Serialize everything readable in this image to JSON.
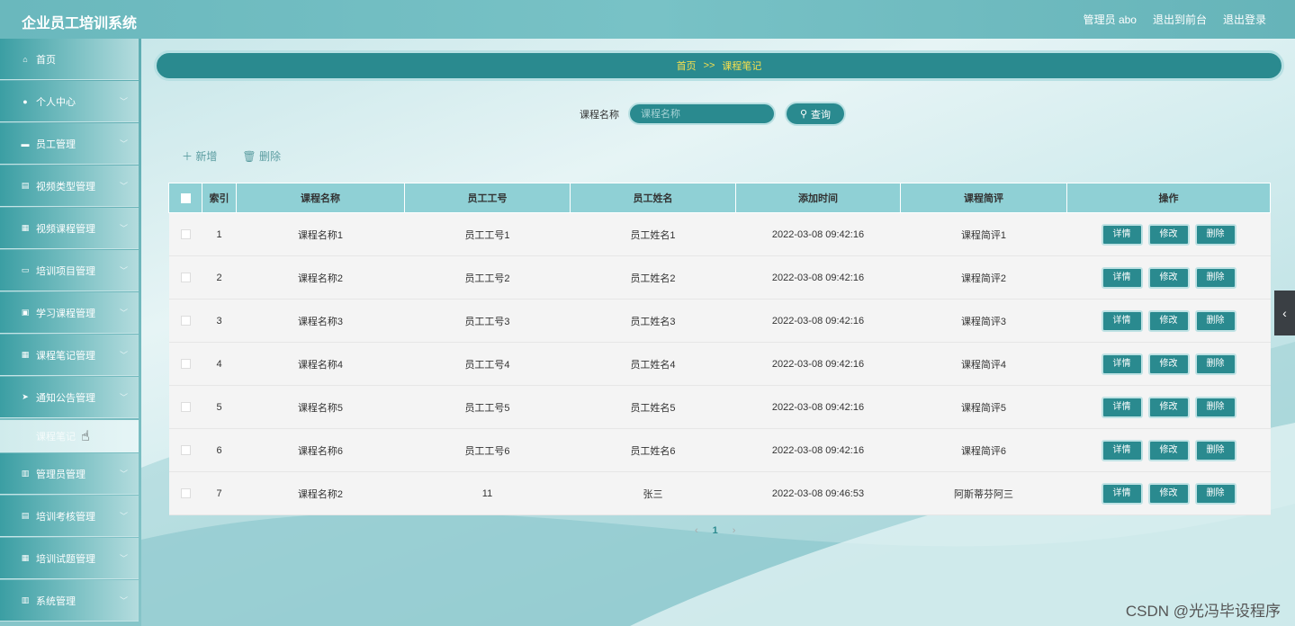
{
  "header": {
    "title": "企业员工培训系统",
    "user": "管理员 abo",
    "to_front": "退出到前台",
    "logout": "退出登录"
  },
  "sidebar": {
    "items": [
      {
        "label": "首页",
        "icon": "home-icon",
        "glyph": "⌂"
      },
      {
        "label": "个人中心",
        "icon": "user-icon",
        "glyph": "●"
      },
      {
        "label": "员工管理",
        "icon": "briefcase-icon",
        "glyph": "▬"
      },
      {
        "label": "视频类型管理",
        "icon": "document-icon",
        "glyph": "▤"
      },
      {
        "label": "视频课程管理",
        "icon": "grid-icon",
        "glyph": "▦"
      },
      {
        "label": "培训项目管理",
        "icon": "monitor-icon",
        "glyph": "▭"
      },
      {
        "label": "学习课程管理",
        "icon": "id-card-icon",
        "glyph": "▣"
      },
      {
        "label": "课程笔记管理",
        "icon": "grid-icon",
        "glyph": "▦"
      },
      {
        "label": "通知公告管理",
        "icon": "send-icon",
        "glyph": "➤"
      }
    ],
    "submenu_label": "课程笔记",
    "items_after": [
      {
        "label": "管理员管理",
        "icon": "bar-chart-icon",
        "glyph": "▥"
      },
      {
        "label": "培训考核管理",
        "icon": "document-icon",
        "glyph": "▤"
      },
      {
        "label": "培训试题管理",
        "icon": "grid-icon",
        "glyph": "▦"
      },
      {
        "label": "系统管理",
        "icon": "chart-icon",
        "glyph": "▥"
      }
    ]
  },
  "breadcrumb": {
    "home": "首页",
    "sep": ">>",
    "current": "课程笔记"
  },
  "search": {
    "label": "课程名称",
    "placeholder": "课程名称",
    "button": "查询"
  },
  "toolbar": {
    "add": "新增",
    "delete": "删除"
  },
  "table": {
    "columns": [
      "索引",
      "课程名称",
      "员工工号",
      "员工姓名",
      "添加时间",
      "课程简评",
      "操作"
    ],
    "rows": [
      {
        "index": "1",
        "course": "课程名称1",
        "emp_no": "员工工号1",
        "emp_name": "员工姓名1",
        "time": "2022-03-08 09:42:16",
        "review": "课程简评1"
      },
      {
        "index": "2",
        "course": "课程名称2",
        "emp_no": "员工工号2",
        "emp_name": "员工姓名2",
        "time": "2022-03-08 09:42:16",
        "review": "课程简评2"
      },
      {
        "index": "3",
        "course": "课程名称3",
        "emp_no": "员工工号3",
        "emp_name": "员工姓名3",
        "time": "2022-03-08 09:42:16",
        "review": "课程简评3"
      },
      {
        "index": "4",
        "course": "课程名称4",
        "emp_no": "员工工号4",
        "emp_name": "员工姓名4",
        "time": "2022-03-08 09:42:16",
        "review": "课程简评4"
      },
      {
        "index": "5",
        "course": "课程名称5",
        "emp_no": "员工工号5",
        "emp_name": "员工姓名5",
        "time": "2022-03-08 09:42:16",
        "review": "课程简评5"
      },
      {
        "index": "6",
        "course": "课程名称6",
        "emp_no": "员工工号6",
        "emp_name": "员工姓名6",
        "time": "2022-03-08 09:42:16",
        "review": "课程简评6"
      },
      {
        "index": "7",
        "course": "课程名称2",
        "emp_no": "11",
        "emp_name": "张三",
        "time": "2022-03-08 09:46:53",
        "review": "阿斯蒂芬阿三"
      }
    ],
    "ops": {
      "detail": "详情",
      "edit": "修改",
      "delete": "删除"
    }
  },
  "pager": {
    "prev": "‹",
    "current": "1",
    "next": "›"
  },
  "side_toggle": "‹",
  "watermark": "CSDN @光冯毕设程序",
  "colors": {
    "primary": "#2a8a8f",
    "header_bg": "#6ab8bd",
    "table_head": "#8fd0d5",
    "breadcrumb_text": "#f7e04d"
  }
}
